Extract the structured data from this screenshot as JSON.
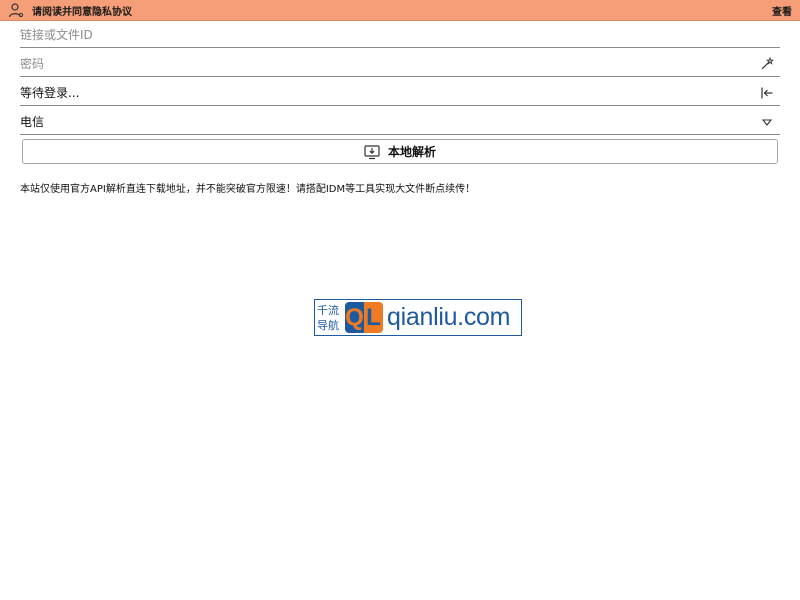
{
  "topbar": {
    "notice": "请阅读并同意隐私协议",
    "view_link": "查看",
    "icon": "user-icon",
    "bg_color": "#f59e78"
  },
  "form": {
    "link_input": {
      "placeholder": "链接或文件ID",
      "value": ""
    },
    "password_input": {
      "placeholder": "密码",
      "value": "",
      "icon": "magic-wand-icon"
    },
    "login_status": {
      "text": "等待登录...",
      "icon": "login-icon"
    },
    "isp_select": {
      "selected": "电信",
      "icon": "chevron-down-icon"
    }
  },
  "parse_button": {
    "label": "本地解析",
    "icon": "monitor-download-icon"
  },
  "notice_text": "本站仅使用官方API解析直连下载地址，并不能突破官方限速！请搭配IDM等工具实现大文件断点续传！",
  "logo": {
    "cn_line1": "千流",
    "cn_line2": "导航",
    "mark_q": "Q",
    "mark_l": "L",
    "domain": "qianliu.com",
    "blue": "#1e5aa0",
    "orange": "#f07a23"
  }
}
